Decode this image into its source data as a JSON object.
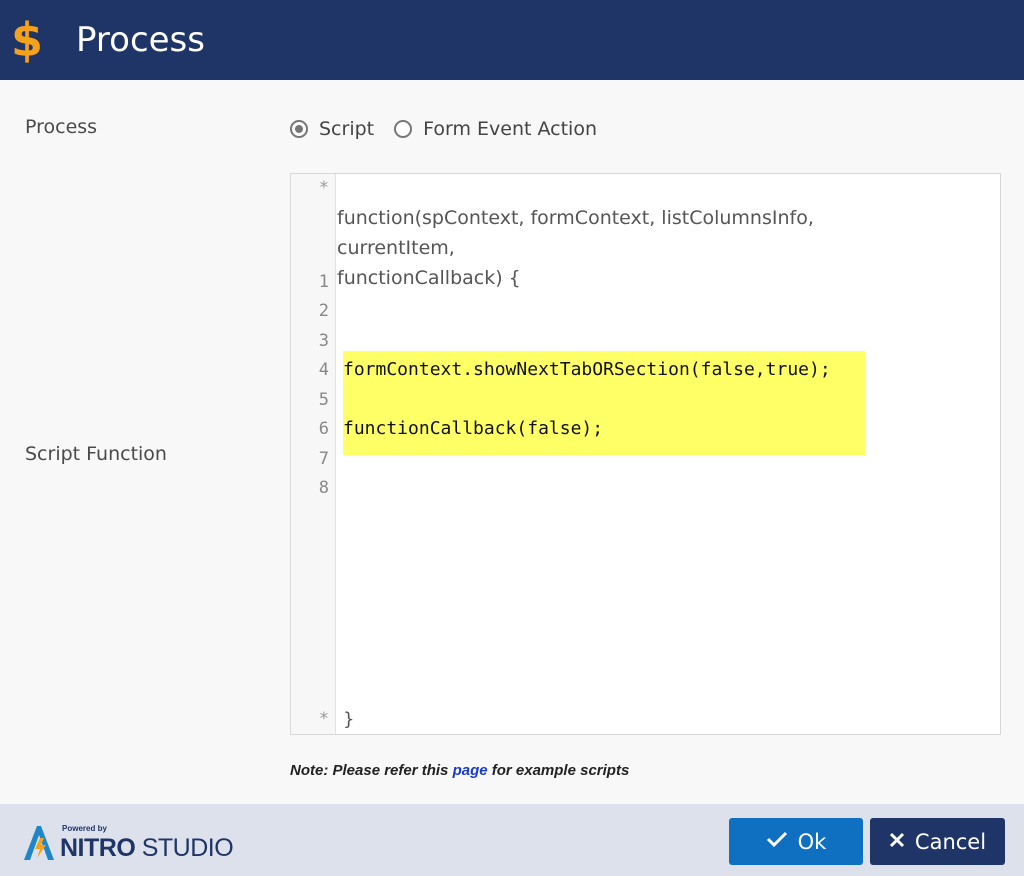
{
  "header": {
    "icon": "dollar-icon",
    "icon_glyph": "$",
    "title": "Process",
    "accent_color": "#f4a21c",
    "background_color": "#203567"
  },
  "form": {
    "process_label": "Process",
    "process_options": [
      {
        "label": "Script",
        "selected": true
      },
      {
        "label": "Form Event Action",
        "selected": false
      }
    ],
    "script_function_label": "Script Function"
  },
  "editor": {
    "marker_top": "*",
    "marker_bottom": "*",
    "signature_line1": "function(spContext, formContext, listColumnsInfo, currentItem,",
    "signature_line2": "functionCallback) {",
    "line_numbers": [
      "1",
      "2",
      "3",
      "4",
      "5",
      "6",
      "7",
      "8"
    ],
    "code_lines": [
      "",
      "",
      "",
      "formContext.showNextTabORSection(false,true);",
      "",
      "functionCallback(false);",
      "",
      ""
    ],
    "closing_brace": "}",
    "highlight_color": "#ffff66"
  },
  "note": {
    "prefix": "Note: Please refer this ",
    "link_text": "page",
    "suffix": " for example scripts"
  },
  "footer": {
    "powered_by": "Powered by",
    "brand_nitro": "NITRO",
    "brand_studio": " STUDIO",
    "ok_label": "Ok",
    "cancel_label": "Cancel",
    "ok_icon": "check-icon",
    "cancel_icon": "close-icon",
    "ok_color": "#0f6fc0",
    "cancel_color": "#203567"
  }
}
